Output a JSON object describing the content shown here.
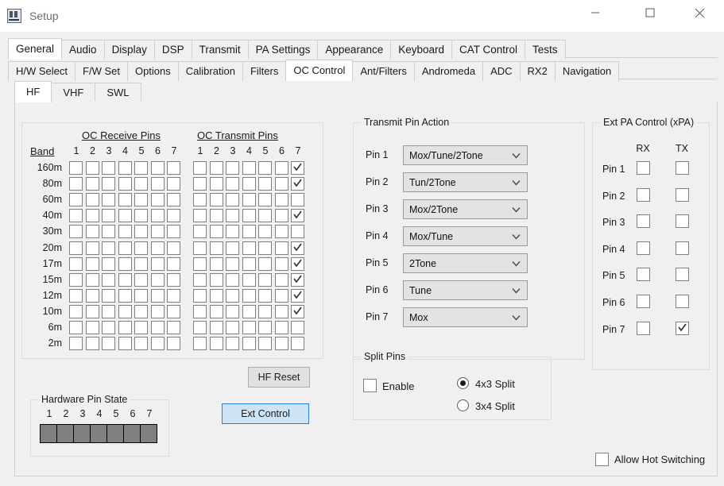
{
  "window": {
    "title": "Setup",
    "icon": "app-icon",
    "controls": {
      "minimize": "minimize-icon",
      "maximize": "maximize-icon",
      "close": "close-icon"
    }
  },
  "tabs_row1": [
    {
      "label": "General",
      "active": true
    },
    {
      "label": "Audio",
      "active": false
    },
    {
      "label": "Display",
      "active": false
    },
    {
      "label": "DSP",
      "active": false
    },
    {
      "label": "Transmit",
      "active": false
    },
    {
      "label": "PA Settings",
      "active": false
    },
    {
      "label": "Appearance",
      "active": false
    },
    {
      "label": "Keyboard",
      "active": false
    },
    {
      "label": "CAT Control",
      "active": false
    },
    {
      "label": "Tests",
      "active": false
    }
  ],
  "tabs_row2": [
    {
      "label": "H/W Select",
      "active": false
    },
    {
      "label": "F/W Set",
      "active": false
    },
    {
      "label": "Options",
      "active": false
    },
    {
      "label": "Calibration",
      "active": false
    },
    {
      "label": "Filters",
      "active": false
    },
    {
      "label": "OC Control",
      "active": true
    },
    {
      "label": "Ant/Filters",
      "active": false
    },
    {
      "label": "Andromeda",
      "active": false
    },
    {
      "label": "ADC",
      "active": false
    },
    {
      "label": "RX2",
      "active": false
    },
    {
      "label": "Navigation",
      "active": false
    }
  ],
  "tabs_row3": [
    {
      "label": "HF",
      "active": true
    },
    {
      "label": "VHF",
      "active": false
    },
    {
      "label": "SWL",
      "active": false
    }
  ],
  "pin_grid": {
    "band_header": "Band",
    "receive_title": "OC Receive Pins",
    "transmit_title": "OC Transmit Pins",
    "columns": [
      "1",
      "2",
      "3",
      "4",
      "5",
      "6",
      "7"
    ],
    "bands": [
      "160m",
      "80m",
      "60m",
      "40m",
      "30m",
      "20m",
      "17m",
      "15m",
      "12m",
      "10m",
      "6m",
      "2m"
    ],
    "receive": [
      [
        false,
        false,
        false,
        false,
        false,
        false,
        false
      ],
      [
        false,
        false,
        false,
        false,
        false,
        false,
        false
      ],
      [
        false,
        false,
        false,
        false,
        false,
        false,
        false
      ],
      [
        false,
        false,
        false,
        false,
        false,
        false,
        false
      ],
      [
        false,
        false,
        false,
        false,
        false,
        false,
        false
      ],
      [
        false,
        false,
        false,
        false,
        false,
        false,
        false
      ],
      [
        false,
        false,
        false,
        false,
        false,
        false,
        false
      ],
      [
        false,
        false,
        false,
        false,
        false,
        false,
        false
      ],
      [
        false,
        false,
        false,
        false,
        false,
        false,
        false
      ],
      [
        false,
        false,
        false,
        false,
        false,
        false,
        false
      ],
      [
        false,
        false,
        false,
        false,
        false,
        false,
        false
      ],
      [
        false,
        false,
        false,
        false,
        false,
        false,
        false
      ]
    ],
    "transmit": [
      [
        false,
        false,
        false,
        false,
        false,
        false,
        true
      ],
      [
        false,
        false,
        false,
        false,
        false,
        false,
        true
      ],
      [
        false,
        false,
        false,
        false,
        false,
        false,
        false
      ],
      [
        false,
        false,
        false,
        false,
        false,
        false,
        true
      ],
      [
        false,
        false,
        false,
        false,
        false,
        false,
        false
      ],
      [
        false,
        false,
        false,
        false,
        false,
        false,
        true
      ],
      [
        false,
        false,
        false,
        false,
        false,
        false,
        true
      ],
      [
        false,
        false,
        false,
        false,
        false,
        false,
        true
      ],
      [
        false,
        false,
        false,
        false,
        false,
        false,
        true
      ],
      [
        false,
        false,
        false,
        false,
        false,
        false,
        true
      ],
      [
        false,
        false,
        false,
        false,
        false,
        false,
        false
      ],
      [
        false,
        false,
        false,
        false,
        false,
        false,
        false
      ]
    ]
  },
  "buttons": {
    "hf_reset": "HF Reset",
    "ext_control": "Ext Control"
  },
  "hardware_pin_state": {
    "legend": "Hardware Pin State",
    "numbers": [
      "1",
      "2",
      "3",
      "4",
      "5",
      "6",
      "7"
    ],
    "states": [
      "off",
      "off",
      "off",
      "off",
      "off",
      "off",
      "off"
    ],
    "off_color": "#808080"
  },
  "transmit_pin_action": {
    "legend": "Transmit Pin Action",
    "rows": [
      {
        "label": "Pin 1",
        "value": "Mox/Tune/2Tone"
      },
      {
        "label": "Pin 2",
        "value": "Tun/2Tone"
      },
      {
        "label": "Pin 3",
        "value": "Mox/2Tone"
      },
      {
        "label": "Pin 4",
        "value": "Mox/Tune"
      },
      {
        "label": "Pin 5",
        "value": "2Tone"
      },
      {
        "label": "Pin 6",
        "value": "Tune"
      },
      {
        "label": "Pin 7",
        "value": "Mox"
      }
    ]
  },
  "ext_pa_control": {
    "legend": "Ext PA Control (xPA)",
    "col_rx": "RX",
    "col_tx": "TX",
    "rows": [
      {
        "label": "Pin 1",
        "rx": false,
        "tx": false
      },
      {
        "label": "Pin 2",
        "rx": false,
        "tx": false
      },
      {
        "label": "Pin 3",
        "rx": false,
        "tx": false
      },
      {
        "label": "Pin 4",
        "rx": false,
        "tx": false
      },
      {
        "label": "Pin 5",
        "rx": false,
        "tx": false
      },
      {
        "label": "Pin 6",
        "rx": false,
        "tx": false
      },
      {
        "label": "Pin 7",
        "rx": false,
        "tx": true
      }
    ]
  },
  "split_pins": {
    "legend": "Split Pins",
    "enable_label": "Enable",
    "enable_checked": false,
    "options": [
      {
        "label": "4x3 Split",
        "selected": true
      },
      {
        "label": "3x4 Split",
        "selected": false
      }
    ]
  },
  "hot_switching": {
    "label": "Allow Hot Switching",
    "checked": false
  },
  "colors": {
    "accent": "#2a7fd4",
    "accent_fill": "#cde4f7",
    "window_bg": "#f0f0f0",
    "pin_off": "#808080"
  }
}
